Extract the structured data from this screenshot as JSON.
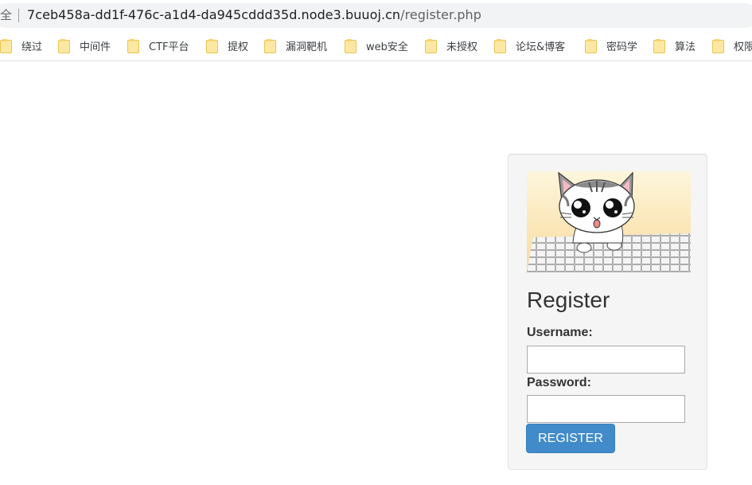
{
  "browser": {
    "security_label": "全",
    "url_host": "7ceb458a-dd1f-476c-a1d4-da945cddd35d.node3.buuoj.cn",
    "url_path": "/register.php",
    "bookmarks": [
      {
        "label": "绕过",
        "icon": "folder-icon"
      },
      {
        "label": "中间件",
        "icon": "folder-icon"
      },
      {
        "label": "CTF平台",
        "icon": "folder-icon"
      },
      {
        "label": "提权",
        "icon": "folder-icon"
      },
      {
        "label": "漏洞靶机",
        "icon": "folder-icon"
      },
      {
        "label": "web安全",
        "icon": "folder-icon"
      },
      {
        "label": "未授权",
        "icon": "folder-icon"
      },
      {
        "label": "论坛&博客",
        "icon": "folder-icon"
      },
      {
        "label": "密码学",
        "icon": "folder-icon"
      },
      {
        "label": "算法",
        "icon": "folder-icon"
      },
      {
        "label": "权限",
        "icon": "folder-icon"
      }
    ]
  },
  "register_form": {
    "image_icon": "cartoon-cat-on-keyboard-image",
    "title": "Register",
    "username_label": "Username:",
    "username_value": "",
    "password_label": "Password:",
    "password_value": "",
    "submit_label": "REGISTER"
  },
  "colors": {
    "button": "#428bca",
    "card_background": "#f5f5f5"
  }
}
